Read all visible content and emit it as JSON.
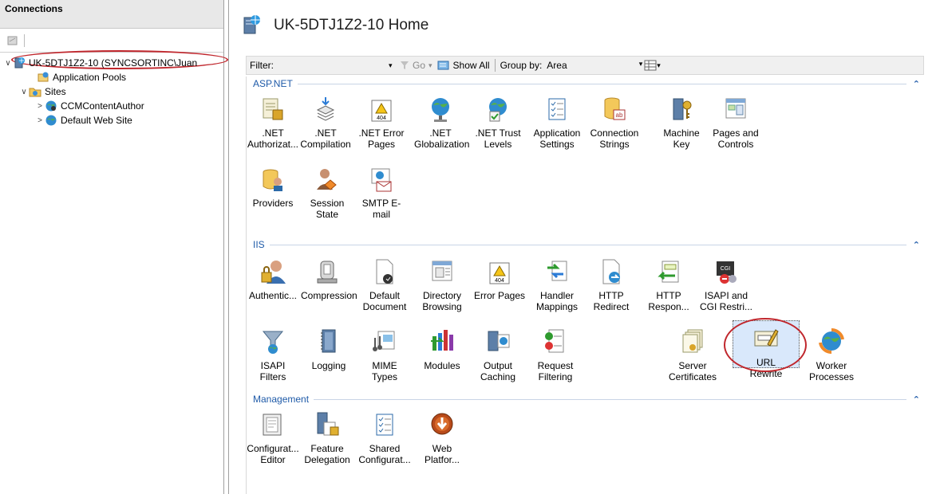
{
  "connections": {
    "title": "Connections",
    "tree": [
      {
        "label": "UK-5DTJ1Z2-10 (SYNCSORTINC\\Juan",
        "level": 0,
        "toggle": "∨",
        "icon": "server-icon"
      },
      {
        "label": "Application Pools",
        "level": 1,
        "toggle": "",
        "icon": "app-pools-icon"
      },
      {
        "label": "Sites",
        "level": 1,
        "toggle": "∨",
        "icon": "sites-folder-icon"
      },
      {
        "label": "CCMContentAuthor",
        "level": 2,
        "toggle": ">",
        "icon": "website-icon"
      },
      {
        "label": "Default Web Site",
        "level": 2,
        "toggle": ">",
        "icon": "website-icon"
      }
    ]
  },
  "home": {
    "title": "UK-5DTJ1Z2-10 Home"
  },
  "filter_bar": {
    "filter_label": "Filter:",
    "go_label": "Go",
    "show_all_label": "Show All",
    "group_by_label": "Group by:",
    "group_by_value": "Area"
  },
  "groups": {
    "aspnet": {
      "label": "ASP.NET",
      "items": [
        {
          "l1": ".NET",
          "l2": "Authorizat..."
        },
        {
          "l1": ".NET",
          "l2": "Compilation"
        },
        {
          "l1": ".NET Error",
          "l2": "Pages"
        },
        {
          "l1": ".NET",
          "l2": "Globalization"
        },
        {
          "l1": ".NET Trust",
          "l2": "Levels"
        },
        {
          "l1": "Application",
          "l2": "Settings"
        },
        {
          "l1": "Connection",
          "l2": "Strings"
        },
        {
          "l1": "Machine Key",
          "l2": ""
        },
        {
          "l1": "Pages and",
          "l2": "Controls"
        },
        {
          "l1": "Providers",
          "l2": ""
        },
        {
          "l1": "Session State",
          "l2": ""
        },
        {
          "l1": "SMTP E-mail",
          "l2": ""
        }
      ]
    },
    "iis": {
      "label": "IIS",
      "items": [
        {
          "l1": "Authentic...",
          "l2": ""
        },
        {
          "l1": "Compression",
          "l2": ""
        },
        {
          "l1": "Default",
          "l2": "Document"
        },
        {
          "l1": "Directory",
          "l2": "Browsing"
        },
        {
          "l1": "Error Pages",
          "l2": ""
        },
        {
          "l1": "Handler",
          "l2": "Mappings"
        },
        {
          "l1": "HTTP",
          "l2": "Redirect"
        },
        {
          "l1": "HTTP",
          "l2": "Respon..."
        },
        {
          "l1": "ISAPI and",
          "l2": "CGI Restri..."
        },
        {
          "l1": "ISAPI Filters",
          "l2": ""
        },
        {
          "l1": "Logging",
          "l2": ""
        },
        {
          "l1": "MIME Types",
          "l2": ""
        },
        {
          "l1": "Modules",
          "l2": ""
        },
        {
          "l1": "Output",
          "l2": "Caching"
        },
        {
          "l1": "Request",
          "l2": "Filtering"
        },
        {
          "l1": "Server",
          "l2": "Certificates"
        },
        {
          "l1": "URL Rewrite",
          "l2": ""
        },
        {
          "l1": "Worker",
          "l2": "Processes"
        }
      ]
    },
    "management": {
      "label": "Management",
      "items": [
        {
          "l1": "Configurat...",
          "l2": "Editor"
        },
        {
          "l1": "Feature",
          "l2": "Delegation"
        },
        {
          "l1": "Shared",
          "l2": "Configurat..."
        },
        {
          "l1": "Web",
          "l2": "Platfor..."
        }
      ]
    }
  },
  "colors": {
    "accent": "#1e5aa8",
    "highlight_ring": "#c0272d",
    "selection": "#d9e8fb"
  }
}
